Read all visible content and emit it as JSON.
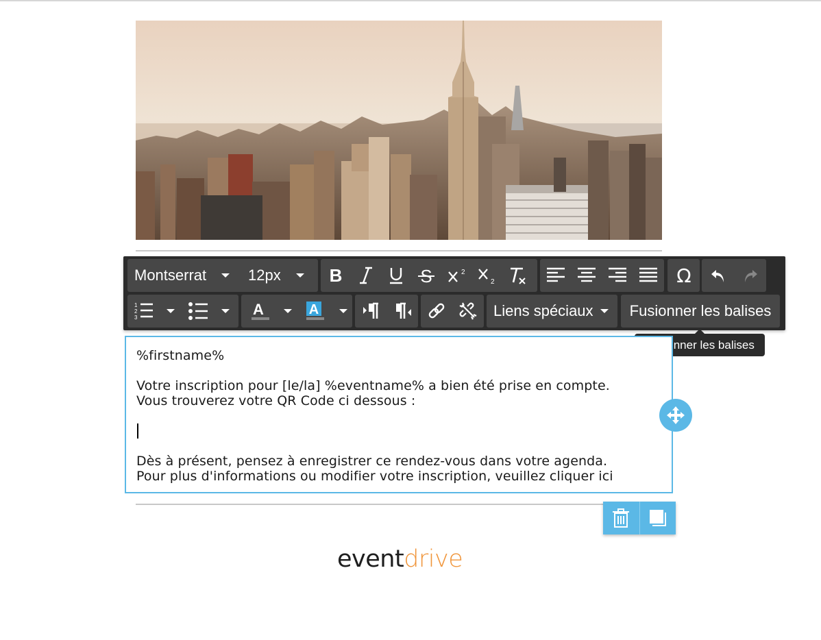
{
  "toolbar": {
    "font_family": "Montserrat",
    "font_size": "12px",
    "special_links_label": "Liens spéciaux",
    "merge_tags_label": "Fusionner les balises",
    "redo_enabled": false
  },
  "tooltip": {
    "text": "Fusionner les balises"
  },
  "editor": {
    "lines": [
      "%firstname%",
      "Votre inscription pour [le/la] %eventname% a bien été prise en compte.",
      "Vous trouverez votre QR Code ci dessous :",
      "Dès à présent, pensez à enregistrer ce rendez-vous dans votre agenda.",
      "Pour plus d'informations ou modifier votre inscription, veuillez cliquer ici"
    ]
  },
  "logo": {
    "part1": "event",
    "part2": "drive"
  },
  "colors": {
    "accent": "#5bb8e6",
    "toolbar_bg": "#2b2b2b",
    "toolbar_group": "#474747",
    "logo_orange": "#f0953a",
    "highlight": "#3aa6dd"
  }
}
